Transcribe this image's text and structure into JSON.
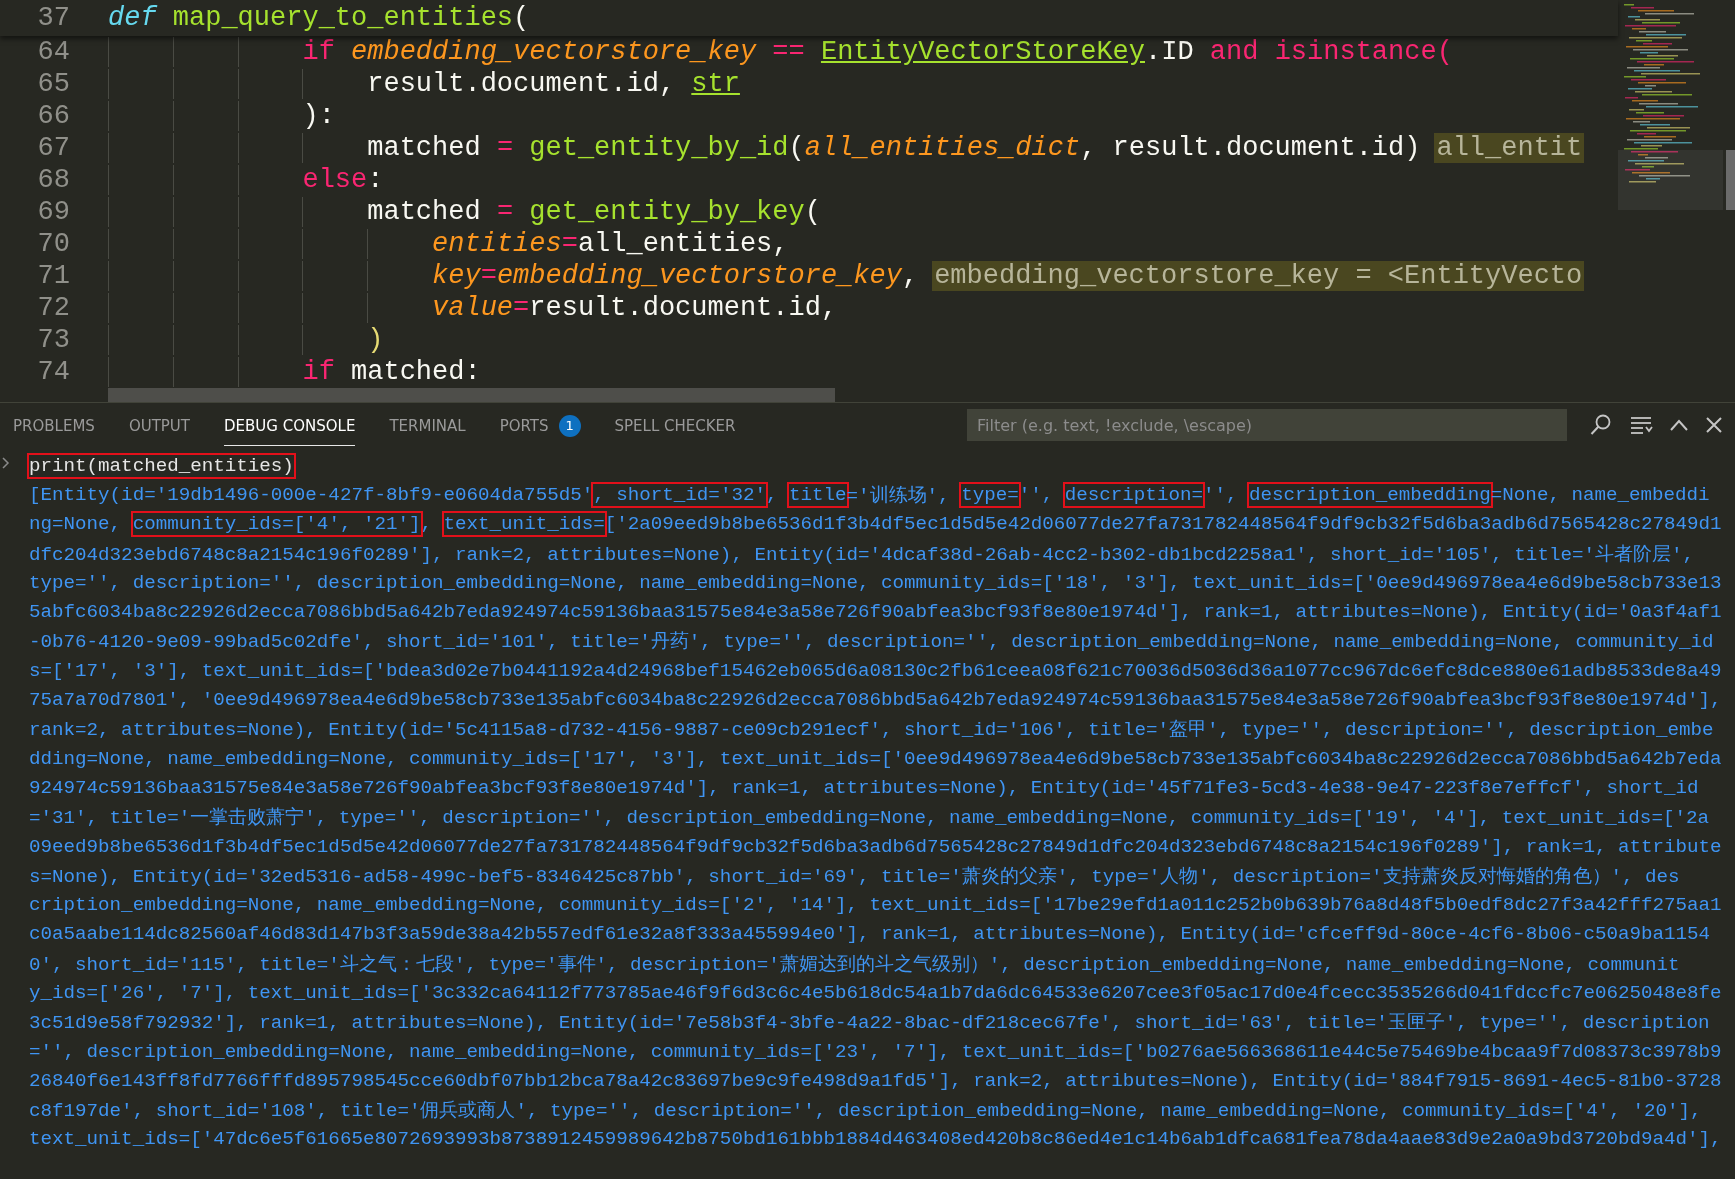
{
  "editor": {
    "sticky_line": {
      "number": "37",
      "tokens": [
        {
          "text": "def ",
          "kind": "storage"
        },
        {
          "text": "map_query_to_entities",
          "kind": "function"
        },
        {
          "text": "(",
          "kind": "plain"
        }
      ]
    },
    "lines": [
      {
        "number": "64",
        "tokens": [
          {
            "text": "            if ",
            "kind": "keyword"
          },
          {
            "text": "embedding_vectorstore_key ",
            "kind": "param"
          },
          {
            "text": "== ",
            "kind": "keyword"
          },
          {
            "text": "EntityVectorStoreKey",
            "kind": "type"
          },
          {
            "text": ".ID ",
            "kind": "plain"
          },
          {
            "text": "and ",
            "kind": "keyword"
          },
          {
            "text": "isinstance(",
            "kind": "keyword"
          }
        ]
      },
      {
        "number": "65",
        "tokens": [
          {
            "text": "                result.document.id, ",
            "kind": "plain"
          },
          {
            "text": "str",
            "kind": "type"
          }
        ]
      },
      {
        "number": "66",
        "tokens": [
          {
            "text": "            ):",
            "kind": "plain"
          }
        ]
      },
      {
        "number": "67",
        "tokens": [
          {
            "text": "                matched ",
            "kind": "plain"
          },
          {
            "text": "= ",
            "kind": "keyword"
          },
          {
            "text": "get_entity_by_id",
            "kind": "function"
          },
          {
            "text": "(",
            "kind": "plain"
          },
          {
            "text": "all_entities_dict",
            "kind": "param"
          },
          {
            "text": ", result.document.id)",
            "kind": "plain"
          }
        ],
        "hint": "all_entit"
      },
      {
        "number": "68",
        "tokens": [
          {
            "text": "            else",
            "kind": "keyword"
          },
          {
            "text": ":",
            "kind": "plain"
          }
        ]
      },
      {
        "number": "69",
        "tokens": [
          {
            "text": "                matched ",
            "kind": "plain"
          },
          {
            "text": "= ",
            "kind": "keyword"
          },
          {
            "text": "get_entity_by_key",
            "kind": "function"
          },
          {
            "text": "(",
            "kind": "plain"
          }
        ]
      },
      {
        "number": "70",
        "tokens": [
          {
            "text": "                    entities",
            "kind": "param"
          },
          {
            "text": "=",
            "kind": "keyword"
          },
          {
            "text": "all_entities,",
            "kind": "plain"
          }
        ]
      },
      {
        "number": "71",
        "tokens": [
          {
            "text": "                    key",
            "kind": "param"
          },
          {
            "text": "=",
            "kind": "keyword"
          },
          {
            "text": "embedding_vectorstore_key",
            "kind": "param"
          },
          {
            "text": ",",
            "kind": "plain"
          }
        ],
        "hint": "embedding_vectorstore_key = <EntityVecto"
      },
      {
        "number": "72",
        "tokens": [
          {
            "text": "                    value",
            "kind": "param"
          },
          {
            "text": "=",
            "kind": "keyword"
          },
          {
            "text": "result.document.id,",
            "kind": "plain"
          }
        ]
      },
      {
        "number": "73",
        "tokens": [
          {
            "text": "                )",
            "kind": "bracket"
          }
        ]
      },
      {
        "number": "74",
        "tokens": [
          {
            "text": "            if ",
            "kind": "keyword"
          },
          {
            "text": "matched:",
            "kind": "plain"
          }
        ]
      }
    ]
  },
  "panel": {
    "tabs": [
      {
        "label": "PROBLEMS",
        "selected": false
      },
      {
        "label": "OUTPUT",
        "selected": false
      },
      {
        "label": "DEBUG CONSOLE",
        "selected": true
      },
      {
        "label": "TERMINAL",
        "selected": false
      },
      {
        "label": "PORTS",
        "selected": false,
        "badge": "1"
      },
      {
        "label": "SPELL CHECKER",
        "selected": false
      }
    ],
    "filter": {
      "placeholder": "Filter (e.g. text, !exclude, \\escape)"
    }
  },
  "console": {
    "input": {
      "text": "print(matched_entities)",
      "boxed": true
    },
    "output_lines": [
      {
        "segments": [
          {
            "text": "[Entity(id='19db1496-000e-427f-8bf9-e0604da755d5'",
            "boxed": false
          },
          {
            "text": ", short_id='32'",
            "boxed": true
          },
          {
            "text": ", ",
            "boxed": false
          },
          {
            "text": "title",
            "boxed": true
          },
          {
            "text": "='训练场', ",
            "boxed": false
          },
          {
            "text": "type=",
            "boxed": true
          },
          {
            "text": "'', ",
            "boxed": false
          },
          {
            "text": "description=",
            "boxed": true
          },
          {
            "text": "'', ",
            "boxed": false
          },
          {
            "text": "description_embedding",
            "boxed": true
          },
          {
            "text": "=None, name_embeddi",
            "boxed": false
          }
        ]
      },
      {
        "segments": [
          {
            "text": "ng=None, ",
            "boxed": false
          },
          {
            "text": "community_ids=['4', '21']",
            "boxed": true
          },
          {
            "text": ", ",
            "boxed": false
          },
          {
            "text": "text_unit_ids=",
            "boxed": true
          },
          {
            "text": "['2a09eed9b8be6536d1f3b4df5ec1d5d5e42d06077de27fa731782448564f9df9cb32f5d6ba3adb6d7565428c27849d1",
            "boxed": false
          }
        ]
      },
      {
        "segments": [
          {
            "text": "dfc204d323ebd6748c8a2154c196f0289'], rank=2, attributes=None), Entity(id='4dcaf38d-26ab-4cc2-b302-db1bcd2258a1', short_id='105', title='斗者阶层',",
            "boxed": false
          }
        ]
      },
      {
        "segments": [
          {
            "text": "type='', description='', description_embedding=None, name_embedding=None, community_ids=['18', '3'], text_unit_ids=['0ee9d496978ea4e6d9be58cb733e13",
            "boxed": false
          }
        ]
      },
      {
        "segments": [
          {
            "text": "5abfc6034ba8c22926d2ecca7086bbd5a642b7eda924974c59136baa31575e84e3a58e726f90abfea3bcf93f8e80e1974d'], rank=1, attributes=None), Entity(id='0a3f4af1",
            "boxed": false
          }
        ]
      },
      {
        "segments": [
          {
            "text": "-0b76-4120-9e09-99bad5c02dfe', short_id='101', title='丹药', type='', description='', description_embedding=None, name_embedding=None, community_id",
            "boxed": false
          }
        ]
      },
      {
        "segments": [
          {
            "text": "s=['17', '3'], text_unit_ids=['bdea3d02e7b0441192a4d24968bef15462eb065d6a08130c2fb61ceea08f621c70036d5036d36a1077cc967dc6efc8dce880e61adb8533de8a49",
            "boxed": false
          }
        ]
      },
      {
        "segments": [
          {
            "text": "75a7a70d7801', '0ee9d496978ea4e6d9be58cb733e135abfc6034ba8c22926d2ecca7086bbd5a642b7eda924974c59136baa31575e84e3a58e726f90abfea3bcf93f8e80e1974d'],",
            "boxed": false
          }
        ]
      },
      {
        "segments": [
          {
            "text": "rank=2, attributes=None), Entity(id='5c4115a8-d732-4156-9887-ce09cb291ecf', short_id='106', title='盔甲', type='', description='', description_embe",
            "boxed": false
          }
        ]
      },
      {
        "segments": [
          {
            "text": "dding=None, name_embedding=None, community_ids=['17', '3'], text_unit_ids=['0ee9d496978ea4e6d9be58cb733e135abfc6034ba8c22926d2ecca7086bbd5a642b7eda",
            "boxed": false
          }
        ]
      },
      {
        "segments": [
          {
            "text": "924974c59136baa31575e84e3a58e726f90abfea3bcf93f8e80e1974d'], rank=1, attributes=None), Entity(id='45f71fe3-5cd3-4e38-9e47-223f8e7effcf', short_id",
            "boxed": false
          }
        ]
      },
      {
        "segments": [
          {
            "text": "='31', title='一掌击败萧宁', type='', description='', description_embedding=None, name_embedding=None, community_ids=['19', '4'], text_unit_ids=['2a",
            "boxed": false
          }
        ]
      },
      {
        "segments": [
          {
            "text": "09eed9b8be6536d1f3b4df5ec1d5d5e42d06077de27fa731782448564f9df9cb32f5d6ba3adb6d7565428c27849d1dfc204d323ebd6748c8a2154c196f0289'], rank=1, attribute",
            "boxed": false
          }
        ]
      },
      {
        "segments": [
          {
            "text": "s=None), Entity(id='32ed5316-ad58-499c-bef5-8346425c87bb', short_id='69', title='萧炎的父亲', type='人物', description='支持萧炎反对悔婚的角色）', des",
            "boxed": false
          }
        ]
      },
      {
        "segments": [
          {
            "text": "cription_embedding=None, name_embedding=None, community_ids=['2', '14'], text_unit_ids=['17be29efd1a011c252b0b639b76a8d48f5b0edf8dc27f3a42fff275aa1",
            "boxed": false
          }
        ]
      },
      {
        "segments": [
          {
            "text": "c0a5aabe114dc82560af46d83d147b3f3a59de38a42b557edf61e32a8f333a455994e0'], rank=1, attributes=None), Entity(id='cfceff9d-80ce-4cf6-8b06-c50a9ba1154",
            "boxed": false
          }
        ]
      },
      {
        "segments": [
          {
            "text": "0', short_id='115', title='斗之气：七段', type='事件', description='萧媚达到的斗之气级别）', description_embedding=None, name_embedding=None, communit",
            "boxed": false
          }
        ]
      },
      {
        "segments": [
          {
            "text": "y_ids=['26', '7'], text_unit_ids=['3c332ca64112f773785ae46f9f6d3c6c4e5b618dc54a1b7da6dc64533e6207cee3f05ac17d0e4fcecc3535266d041fdccfc7e0625048e8fe",
            "boxed": false
          }
        ]
      },
      {
        "segments": [
          {
            "text": "3c51d9e58f792932'], rank=1, attributes=None), Entity(id='7e58b3f4-3bfe-4a22-8bac-df218cec67fe', short_id='63', title='玉匣子', type='', description",
            "boxed": false
          }
        ]
      },
      {
        "segments": [
          {
            "text": "='', description_embedding=None, name_embedding=None, community_ids=['23', '7'], text_unit_ids=['b0276ae566368611e44c5e75469be4bcaa9f7d08373c3978b9",
            "boxed": false
          }
        ]
      },
      {
        "segments": [
          {
            "text": "26840f6e143ff8fd7766fffd895798545cce60dbf07bb12bca78a42c83697be9c9fe498d9a1fd5'], rank=2, attributes=None), Entity(id='884f7915-8691-4ec5-81b0-3728",
            "boxed": false
          }
        ]
      },
      {
        "segments": [
          {
            "text": "c8f197de', short_id='108', title='佣兵或商人', type='', description='', description_embedding=None, name_embedding=None, community_ids=['4', '20'],",
            "boxed": false
          }
        ]
      },
      {
        "segments": [
          {
            "text": "text_unit_ids=['47dc6e5f61665e8072693993b8738912459989642b8750bd161bbb1884d463408ed420b8c86ed4e1c14b6ab1dfca681fea78da4aae83d9e2a0a9bd3720bd9a4d'],",
            "boxed": false
          }
        ]
      }
    ]
  }
}
